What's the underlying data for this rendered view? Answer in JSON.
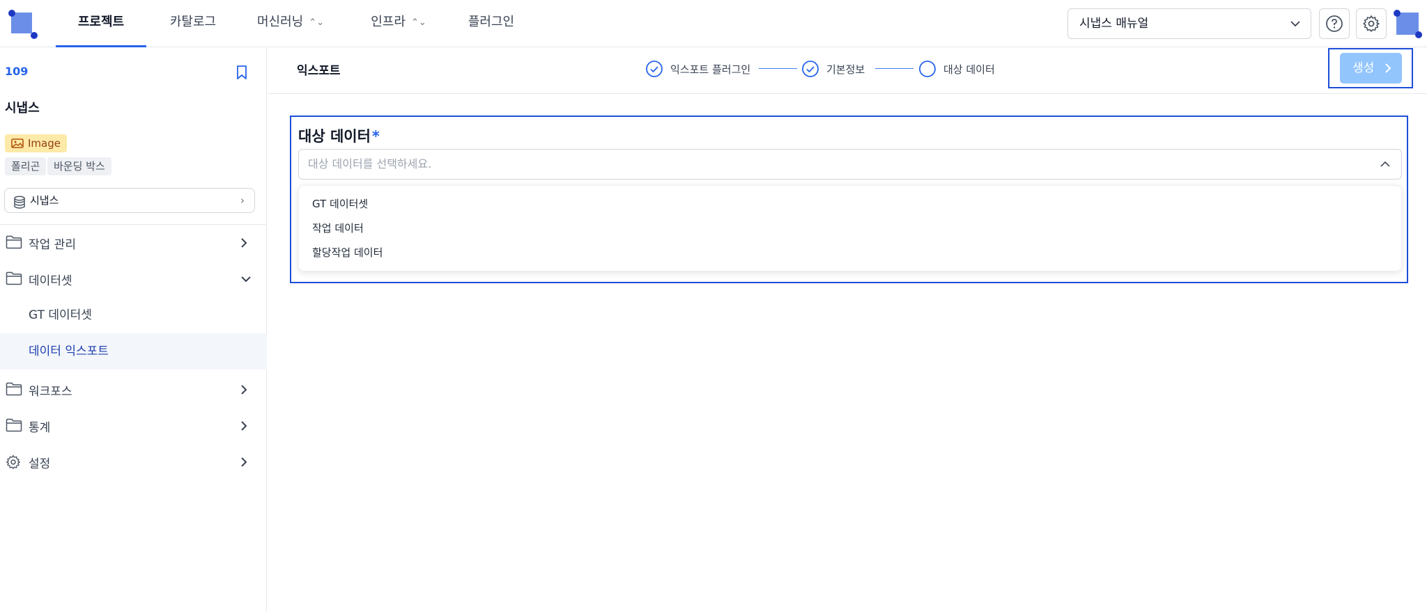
{
  "colors": {
    "accent": "#2563eb",
    "logo": "#6b8fe8",
    "badge_image": "#fde9a8",
    "primary_disabled": "#93c5fd"
  },
  "nav": {
    "tabs": [
      {
        "label": "프로젝트",
        "active": true
      },
      {
        "label": "카탈로그"
      },
      {
        "label": "머신러닝",
        "has_menu": true
      },
      {
        "label": "인프라",
        "has_menu": true
      },
      {
        "label": "플러그인"
      }
    ],
    "manual_select": "시냅스 매뉴얼",
    "help_icon": "help-circle-icon",
    "settings_icon": "gear-icon"
  },
  "sidebar": {
    "project_id": "109",
    "project_name": "시냅스",
    "data_type_badge": "Image",
    "tags": [
      "폴리곤",
      "바운딩 박스"
    ],
    "storage_select": "시냅스",
    "menu": [
      {
        "label": "작업 관리",
        "icon": "folder-icon",
        "expanded": false
      },
      {
        "label": "데이터셋",
        "icon": "folder-icon",
        "expanded": true,
        "children": [
          {
            "label": "GT 데이터셋"
          },
          {
            "label": "데이터 익스포트",
            "active": true
          }
        ]
      },
      {
        "label": "워크포스",
        "icon": "folder-icon",
        "expanded": false
      },
      {
        "label": "통계",
        "icon": "folder-icon",
        "expanded": false
      },
      {
        "label": "설정",
        "icon": "gear-icon",
        "expanded": false
      }
    ]
  },
  "header": {
    "title": "익스포트",
    "steps": [
      {
        "label": "익스포트 플러그인",
        "state": "done"
      },
      {
        "label": "기본정보",
        "state": "done"
      },
      {
        "label": "대상 데이터",
        "state": "current"
      }
    ],
    "create_button": "생성"
  },
  "form": {
    "label": "대상 데이터",
    "required_mark": "*",
    "placeholder": "대상 데이터를 선택하세요.",
    "options": [
      "GT 데이터셋",
      "작업 데이터",
      "할당작업 데이터"
    ]
  }
}
